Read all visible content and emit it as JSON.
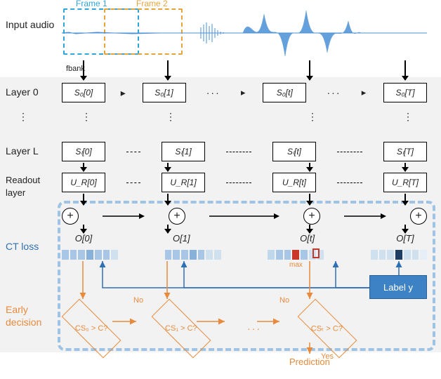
{
  "labels": {
    "input_audio": "Input audio",
    "fbank": "fbank",
    "frame1": "Frame 1",
    "frame2": "Frame 2",
    "layer0": "Layer 0",
    "layerL": "Layer L",
    "readout": "Readout layer",
    "ct_loss": "CT loss",
    "early_decision": "Early decision",
    "max": "max",
    "label_y": "Label y",
    "prediction": "Prediction",
    "yes": "Yes",
    "no": "No",
    "dots": "···",
    "vdots": "⋮"
  },
  "layer0_states": {
    "s0": "S₀[0]",
    "s1": "S₀[1]",
    "st": "S₀[t]",
    "sT": "S₀[T]"
  },
  "layerL_states": {
    "s0": "Sₗ[0]",
    "s1": "Sₗ[1]",
    "st": "Sₗ[t]",
    "sT": "Sₗ[T]"
  },
  "readout_states": {
    "u0": "U_R[0]",
    "u1": "U_R[1]",
    "ut": "U_R[t]",
    "uT": "U_R[T]"
  },
  "outputs": {
    "o0": "O[0]",
    "o1": "O[1]",
    "ot": "O[t]",
    "oT": "O[T]"
  },
  "decisions": {
    "d0": "CS₀ > C?",
    "d1": "CS₁ > C?",
    "dt": "CSₜ > C?"
  },
  "heat_colors": {
    "c0": [
      "#A8C6E5",
      "#A8C6E5",
      "#A8C6E5",
      "#87B1D8",
      "#A8C6E5",
      "#A8C6E5",
      "#CFE0EF"
    ],
    "c1": [
      "#A8C6E5",
      "#A8C6E5",
      "#A8C6E5",
      "#87B1D8",
      "#A8C6E5",
      "#CFE0EF",
      "#CFE0EF"
    ],
    "ct": [
      "#C0D8EC",
      "#A8C6E5",
      "#A8C6E5",
      "#C9362A",
      "#A8C6E5",
      "#CFE0EF",
      "#CFE0EF"
    ],
    "cT": [
      "#CFE0EF",
      "#CFE0EF",
      "#CFE0EF",
      "#1E3F63",
      "#CFE0EF",
      "#CFE0EF",
      "#E6EFF7"
    ]
  },
  "colors": {
    "accent_blue": "#4A90D6",
    "accent_orange": "#E88A3C"
  }
}
